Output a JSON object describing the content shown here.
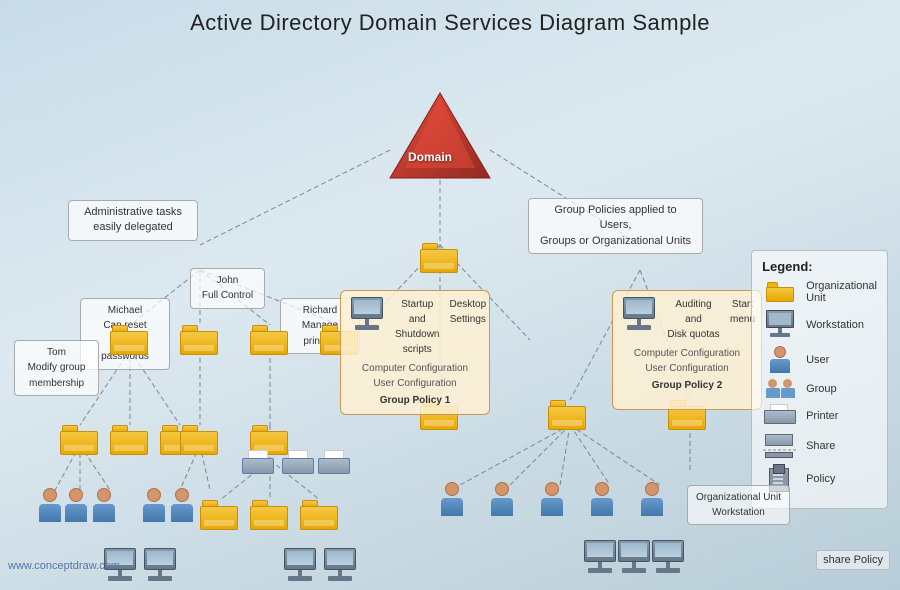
{
  "title": "Active Directory Domain Services Diagram Sample",
  "domain_label": "Domain",
  "annotations": {
    "admin_tasks": "Administrative tasks\neasily delegated",
    "group_policies": "Group Policies applied to Users,\nGroups or Organizational Units",
    "john": "John\nFull Control",
    "michael": "Michael\nCan reset users'\npasswords",
    "tom": "Tom\nModify group\nmembership",
    "richard": "Richard\nManage\nprinters"
  },
  "group_policies": {
    "gp1_title": "Startup and\nShutdown\nscripts",
    "gp1_settings1": "Desktop\nSettings",
    "gp1_comp": "Computer\nConfiguration",
    "gp1_user": "User\nConfiguration",
    "gp1_label": "Group Policy 1",
    "gp2_title": "Auditing and\nDisk quotas",
    "gp2_settings1": "Start\nmenu",
    "gp2_comp": "Computer\nConfiguration",
    "gp2_user": "User\nConfiguration",
    "gp2_label": "Group Policy 2"
  },
  "legend": {
    "title": "Legend:",
    "items": [
      {
        "label": "Organizational\nUnit",
        "icon": "folder"
      },
      {
        "label": "Workstation",
        "icon": "workstation"
      },
      {
        "label": "User",
        "icon": "user"
      },
      {
        "label": "Group",
        "icon": "group"
      },
      {
        "label": "Printer",
        "icon": "printer"
      },
      {
        "label": "Share",
        "icon": "share"
      },
      {
        "label": "Policy",
        "icon": "policy"
      }
    ]
  },
  "watermark": "www.conceptdraw.com",
  "ou_workstation": {
    "line1": "Organizational Unit",
    "line2": "Workstation"
  },
  "share_policy": {
    "line1": "share Policy"
  }
}
